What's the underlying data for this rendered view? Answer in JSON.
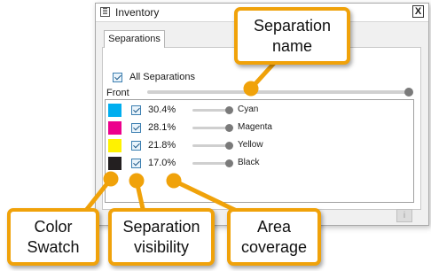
{
  "window": {
    "title": "Inventory",
    "close_label": "X"
  },
  "tabs": [
    {
      "label": "Separations"
    }
  ],
  "all_separations": {
    "label": "All Separations",
    "checked": true
  },
  "front_slider": {
    "label": "Front",
    "level": 1.0
  },
  "separations": [
    {
      "color": "#00aeef",
      "visible": true,
      "coverage": "30.4%",
      "name": "Cyan"
    },
    {
      "color": "#ec008c",
      "visible": true,
      "coverage": "28.1%",
      "name": "Magenta"
    },
    {
      "color": "#fff200",
      "visible": true,
      "coverage": "21.8%",
      "name": "Yellow"
    },
    {
      "color": "#231f20",
      "visible": true,
      "coverage": "17.0%",
      "name": "Black"
    }
  ],
  "info_button": {
    "label": "i"
  },
  "callouts": {
    "separation_name": "Separation\nname",
    "color_swatch": "Color\nSwatch",
    "separation_visibility": "Separation\nvisibility",
    "area_coverage": "Area\ncoverage"
  },
  "accent_color": "#f0a20a"
}
